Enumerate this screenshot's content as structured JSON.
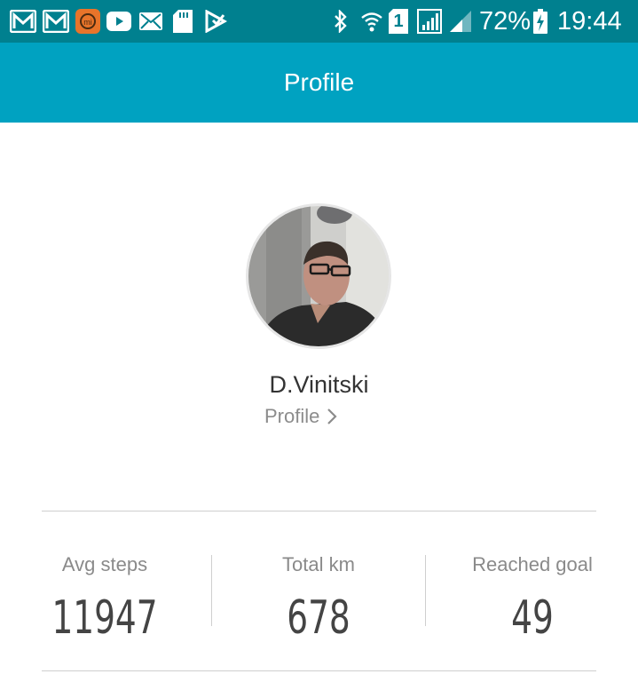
{
  "status_bar": {
    "battery": "72%",
    "time": "19:44",
    "sim_slot": "1",
    "icons": [
      "gmail-icon",
      "gmail-icon",
      "mi-app-icon",
      "youtube-icon",
      "mail-icon",
      "sd-card-icon",
      "play-store-icon",
      "bluetooth-icon",
      "wifi-icon",
      "sim-1-icon",
      "signal-icon",
      "signal-icon",
      "battery-charging-icon"
    ]
  },
  "app_bar": {
    "title": "Profile"
  },
  "profile": {
    "name": "D.Vinitski",
    "link_label": "Profile"
  },
  "stats": [
    {
      "label": "Avg steps",
      "value": "11947"
    },
    {
      "label": "Total km",
      "value": "678"
    },
    {
      "label": "Reached goal",
      "value": "49"
    }
  ],
  "colors": {
    "status_bar": "#00808f",
    "app_bar": "#00a2c1",
    "text_primary": "#333333",
    "text_secondary": "#8a8a8a"
  }
}
